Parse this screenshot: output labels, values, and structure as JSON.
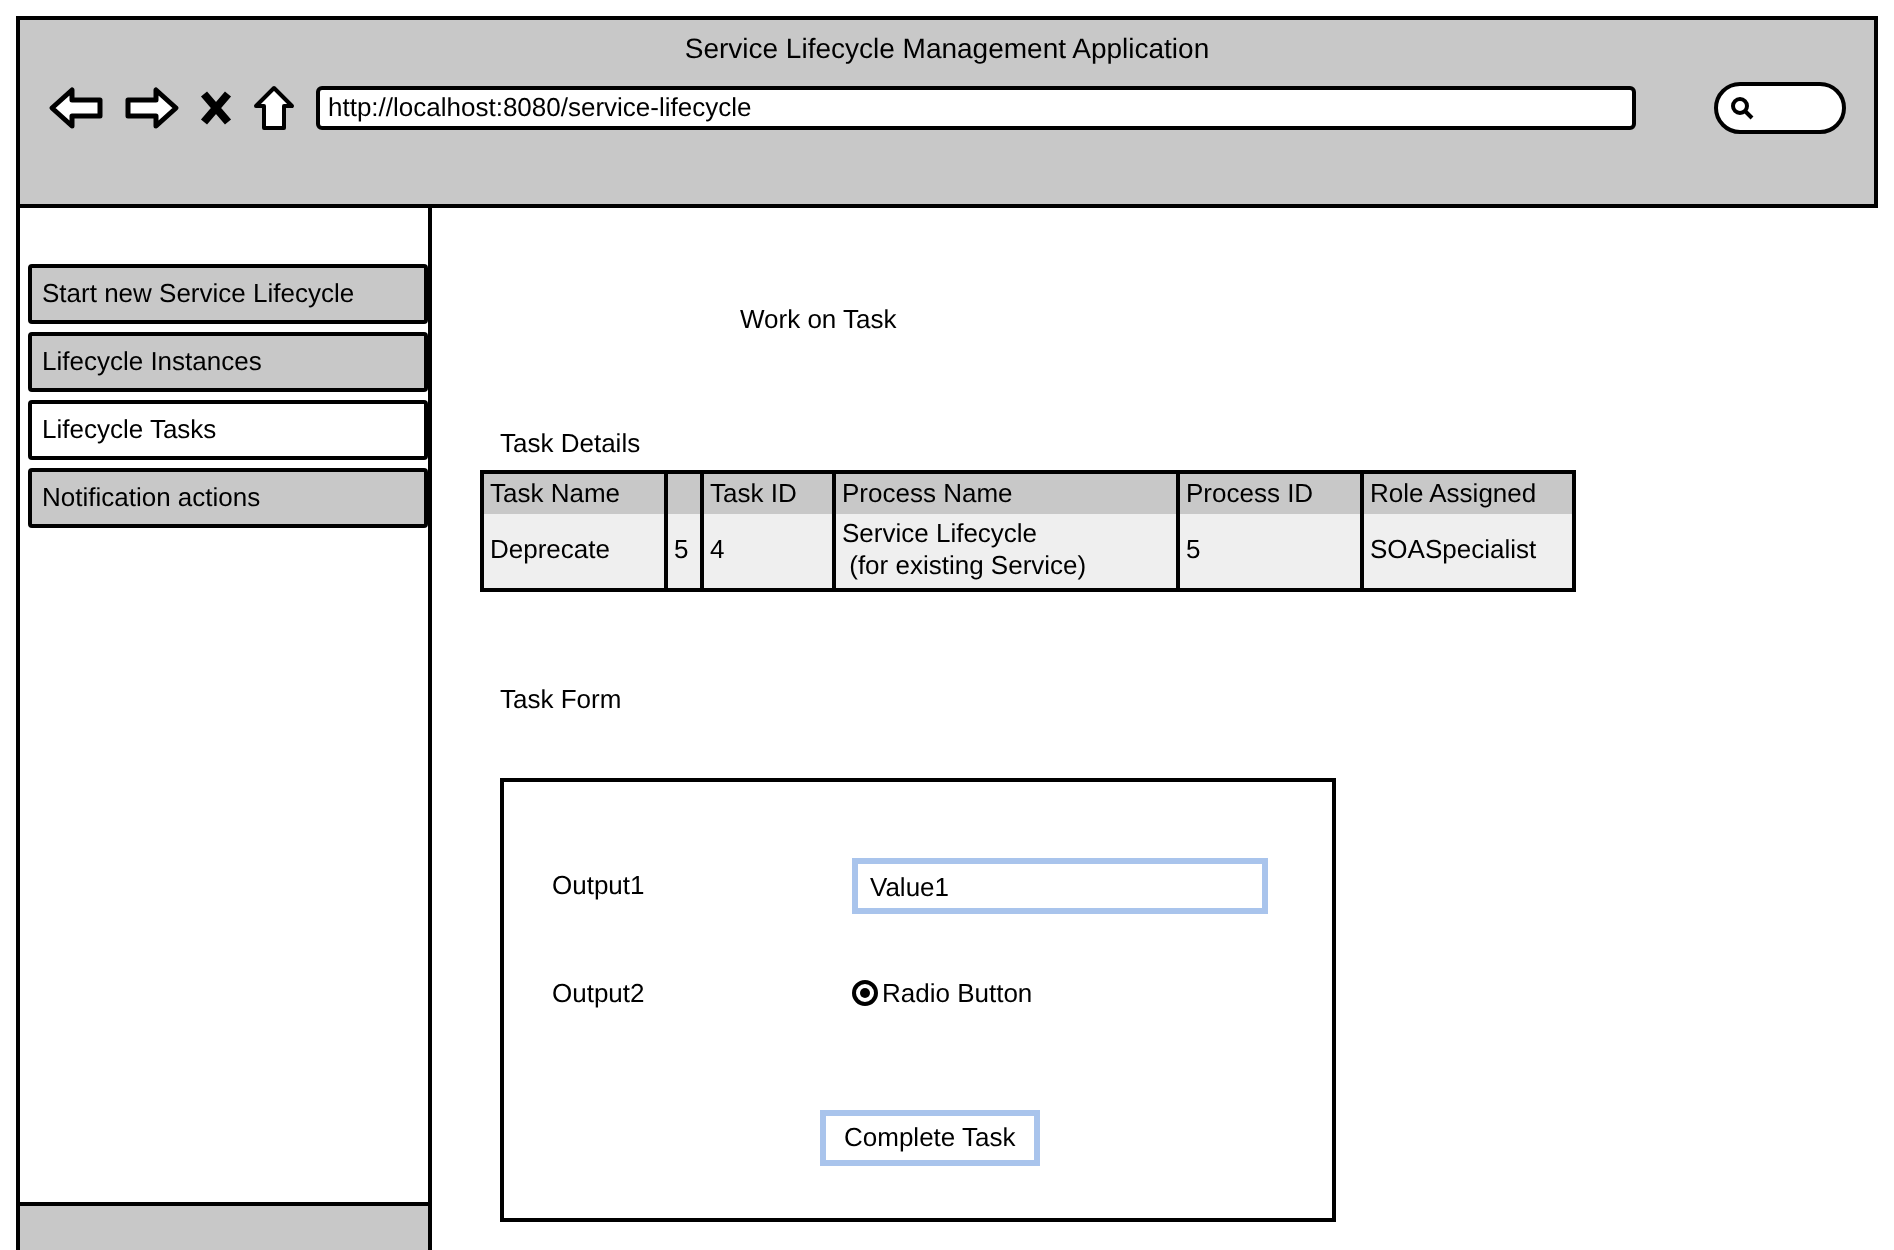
{
  "window": {
    "title": "Service Lifecycle Management Application",
    "url": "http://localhost:8080/service-lifecycle"
  },
  "sidebar": {
    "items": [
      {
        "label": "Start new Service Lifecycle",
        "selected": false
      },
      {
        "label": "Lifecycle Instances",
        "selected": false
      },
      {
        "label": "Lifecycle Tasks",
        "selected": true
      },
      {
        "label": "Notification actions",
        "selected": false
      }
    ]
  },
  "page": {
    "heading": "Work on Task",
    "details_title": "Task Details",
    "form_title": "Task Form"
  },
  "table": {
    "columns": [
      {
        "label": "Task Name"
      },
      {},
      {
        "label": "Task ID"
      },
      {
        "label": "Process Name"
      },
      {
        "label": "Process ID"
      },
      {
        "label": "Role Assigned"
      }
    ],
    "rows": [
      [
        "Deprecate",
        "5",
        "4",
        "Service Lifecycle\n (for existing Service)",
        "5",
        "SOASpecialist"
      ]
    ]
  },
  "form": {
    "fields": [
      {
        "kind": "text",
        "label": "Output1",
        "value": "Value1"
      },
      {
        "kind": "radio",
        "label": "Output2",
        "option": "Radio Button",
        "selected": true
      }
    ],
    "submit": "Complete Task"
  }
}
